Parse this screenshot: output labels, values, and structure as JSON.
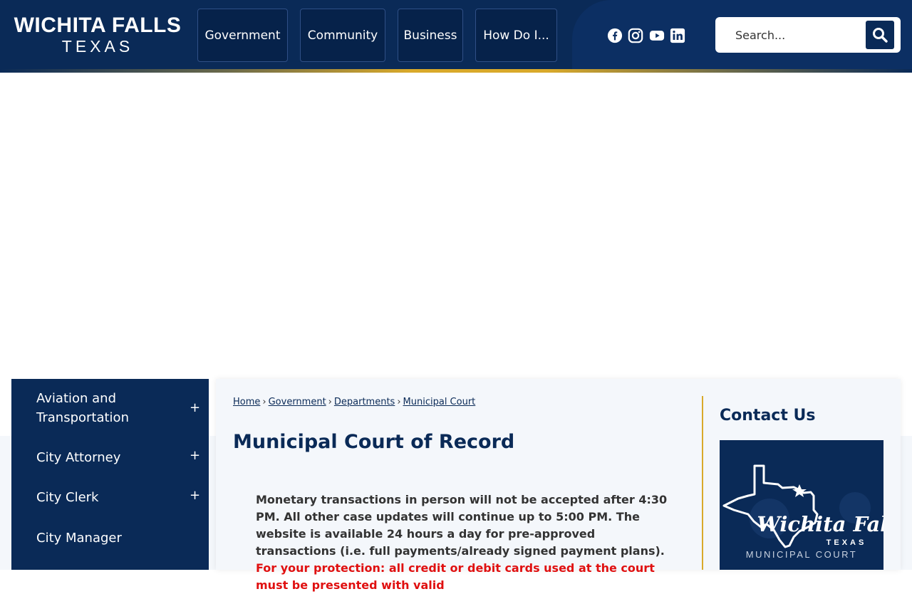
{
  "header": {
    "logo_line1": "WICHITA FALLS",
    "logo_line2": "TEXAS",
    "nav": [
      "Government",
      "Community",
      "Business",
      "How Do I..."
    ],
    "social": [
      "facebook-icon",
      "instagram-icon",
      "youtube-icon",
      "linkedin-icon"
    ],
    "search_placeholder": "Search...",
    "colors": {
      "primary": "#0a2a57",
      "gold": "#d9a92a"
    }
  },
  "sidebar": {
    "items": [
      {
        "label": "Aviation and Transportation",
        "toggle": "+"
      },
      {
        "label": "City Attorney",
        "toggle": "+"
      },
      {
        "label": "City Clerk",
        "toggle": "+"
      },
      {
        "label": "City Manager",
        "toggle": ""
      }
    ]
  },
  "breadcrumb": [
    "Home",
    "Government",
    "Departments",
    "Municipal Court"
  ],
  "breadcrumb_sep": "›",
  "page_title": "Municipal Court of Record",
  "notice": {
    "text": "Monetary transactions in person will not be accepted after 4:30 PM. All other case updates will continue up to 5:00 PM. The website is available 24 hours a day for pre-approved transactions (i.e. full payments/already signed payment plans).",
    "warning": "For your protection: all credit or debit cards used at the court must be presented with valid"
  },
  "contact": {
    "title": "Contact Us",
    "logo_script": "Wichita Falls",
    "logo_state": "TEXAS",
    "logo_sub": "MUNICIPAL COURT"
  }
}
